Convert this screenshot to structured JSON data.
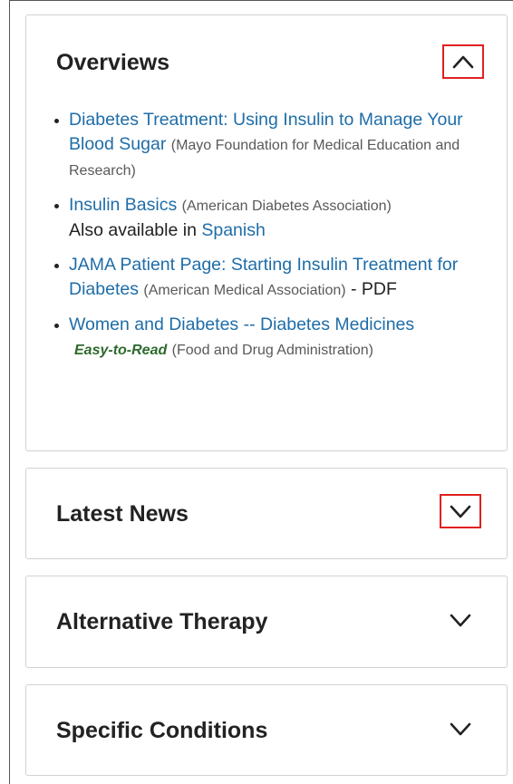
{
  "sections": [
    {
      "title": "Overviews",
      "expanded": true,
      "items": [
        {
          "link": "Diabetes Treatment: Using Insulin to Manage Your Blood Sugar",
          "source": "(Mayo Foundation for Medical Education and Research)"
        },
        {
          "link": "Insulin Basics",
          "source": "(American Diabetes Association)",
          "extra_prefix": "Also available in",
          "extra_link": "Spanish"
        },
        {
          "link": "JAMA Patient Page: Starting Insulin Treatment for Diabetes",
          "source": "(American Medical Association)",
          "suffix": "- PDF"
        },
        {
          "link": "Women and Diabetes -- Diabetes Medicines",
          "badge": "Easy-to-Read",
          "source": "(Food and Drug Administration)"
        }
      ]
    },
    {
      "title": "Latest News",
      "expanded": false
    },
    {
      "title": "Alternative Therapy",
      "expanded": false
    },
    {
      "title": "Specific Conditions",
      "expanded": false
    }
  ],
  "colors": {
    "link": "#1e6da8",
    "highlight_box": "#e0201f",
    "easy_to_read": "#2e6a2e"
  },
  "icons": {
    "expanded": "chevron-up-icon",
    "collapsed": "chevron-down-icon"
  }
}
